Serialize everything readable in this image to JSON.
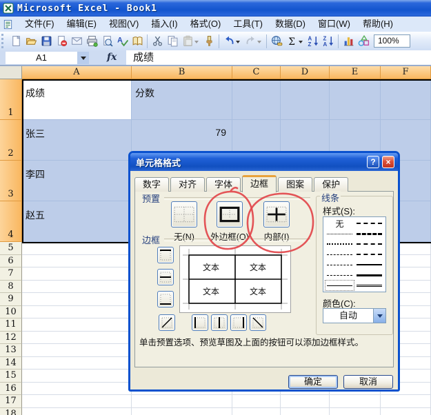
{
  "window": {
    "title": "Microsoft Excel - Book1"
  },
  "menu": {
    "items": [
      "文件(F)",
      "编辑(E)",
      "视图(V)",
      "插入(I)",
      "格式(O)",
      "工具(T)",
      "数据(D)",
      "窗口(W)",
      "帮助(H)"
    ]
  },
  "toolbar": {
    "zoom_value": "100%",
    "icons": [
      {
        "name": "new-document"
      },
      {
        "name": "open"
      },
      {
        "name": "save"
      },
      {
        "name": "permission"
      },
      {
        "name": "mail"
      },
      {
        "name": "print"
      },
      {
        "name": "print-preview"
      },
      {
        "name": "spelling"
      },
      {
        "name": "research"
      },
      {
        "sep": true
      },
      {
        "name": "cut"
      },
      {
        "name": "copy"
      },
      {
        "name": "paste",
        "dd": true,
        "disabled": true
      },
      {
        "name": "format-painter"
      },
      {
        "sep": true
      },
      {
        "name": "undo",
        "dd": true
      },
      {
        "name": "redo",
        "dd": true,
        "disabled": true
      },
      {
        "sep": true
      },
      {
        "name": "insert-hyperlink"
      },
      {
        "name": "autosum",
        "dd": true
      },
      {
        "name": "sort-ascending"
      },
      {
        "name": "sort-descending"
      },
      {
        "sep": true
      },
      {
        "name": "chart-wizard"
      },
      {
        "name": "drawing"
      }
    ]
  },
  "formula_bar": {
    "name_box": "A1",
    "fx": "fx",
    "value": "成绩"
  },
  "sheet": {
    "columns": [
      {
        "label": "A",
        "w": "w-a"
      },
      {
        "label": "B",
        "w": "w-b"
      },
      {
        "label": "C",
        "w": "w-c"
      },
      {
        "label": "D",
        "w": "w-d"
      },
      {
        "label": "E",
        "w": "w-e"
      },
      {
        "label": "F",
        "w": "w-f"
      }
    ],
    "top_rows": [
      {
        "n": "1",
        "a": "成绩",
        "b": "分数",
        "a_cls": "active",
        "b_cls": ""
      },
      {
        "n": "2",
        "a": "张三",
        "b": "79",
        "a_cls": "",
        "b_cls": "num"
      },
      {
        "n": "3",
        "a": "李四",
        "b": "",
        "a_cls": "",
        "b_cls": ""
      },
      {
        "n": "4",
        "a": "赵五",
        "b": "",
        "a_cls": "",
        "b_cls": ""
      }
    ],
    "bottom_rows": [
      "5",
      "6",
      "7",
      "8",
      "9",
      "10",
      "11",
      "12",
      "13",
      "14",
      "15",
      "16",
      "17",
      "18"
    ]
  },
  "dialog": {
    "title": "单元格格式",
    "help_label": "?",
    "close_label": "×",
    "tabs": [
      {
        "label": "数字",
        "cls": ""
      },
      {
        "label": "对齐",
        "cls": ""
      },
      {
        "label": "字体",
        "cls": ""
      },
      {
        "label": "边框",
        "cls": "active"
      },
      {
        "label": "图案",
        "cls": ""
      },
      {
        "label": "保护",
        "cls": ""
      }
    ],
    "presets": {
      "caption": "预置",
      "items": [
        "无(N)",
        "外边框(O)",
        "内部(I)"
      ]
    },
    "border": {
      "caption": "边框",
      "preview_text": "文本"
    },
    "line": {
      "caption": "线条",
      "style_label": "样式(S):",
      "none_label": "无",
      "styles": [
        {
          "left": "none",
          "right": "dashdotdot-m"
        },
        {
          "left": "dot-fine",
          "right": "dash-m2"
        },
        {
          "left": "dot",
          "right": "dashdot-m"
        },
        {
          "left": "dashdotdot",
          "right": "dash-m"
        },
        {
          "left": "dashdot",
          "right": "solid-m"
        },
        {
          "left": "dash",
          "right": "solid-b"
        },
        {
          "left": "solid-sel",
          "right": "double"
        }
      ],
      "color_label": "颜色(C):",
      "color_value": "自动"
    },
    "hint": "单击预置选项、预览草图及上面的按钮可以添加边框样式。",
    "ok_label": "确定",
    "cancel_label": "取消"
  }
}
